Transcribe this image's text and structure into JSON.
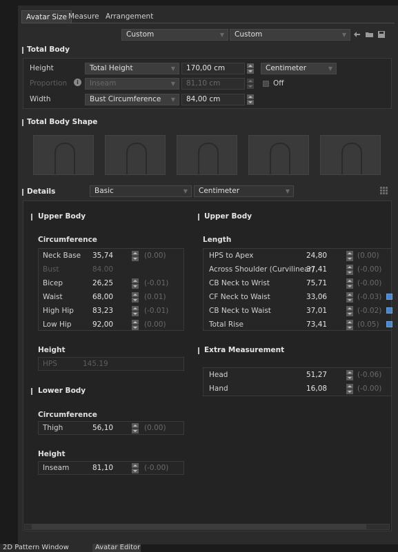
{
  "tabs": [
    "Avatar Size",
    "Measure",
    "Arrangement"
  ],
  "presets": {
    "left": "Custom",
    "right": "Custom"
  },
  "total_body": {
    "title": "Total Body",
    "rows": [
      {
        "label": "Height",
        "dropdown": "Total Height",
        "value": "170,00 cm",
        "unit_dropdown": "Centimeter"
      },
      {
        "label": "Proportion",
        "dropdown": "Inseam",
        "value": "81,10 cm",
        "toggle_label": "Off"
      },
      {
        "label": "Width",
        "dropdown": "Bust Circumference",
        "value": "84,00 cm"
      }
    ]
  },
  "total_body_shape": {
    "title": "Total Body Shape"
  },
  "details": {
    "title": "Details",
    "level_dropdown": "Basic",
    "unit_dropdown": "Centimeter"
  },
  "upper_body_left": {
    "title": "Upper Body",
    "circumference_title": "Circumference",
    "circumference": [
      {
        "name": "Neck Base",
        "value": "35,74",
        "delta": "(0.00)"
      },
      {
        "name": "Bust",
        "value": "84.00",
        "delta": ""
      },
      {
        "name": "Bicep",
        "value": "26,25",
        "delta": "(-0.01)"
      },
      {
        "name": "Waist",
        "value": "68,00",
        "delta": "(0.01)"
      },
      {
        "name": "High Hip",
        "value": "83,23",
        "delta": "(-0.01)"
      },
      {
        "name": "Low Hip",
        "value": "92,00",
        "delta": "(0.00)"
      }
    ],
    "height_title": "Height",
    "height": [
      {
        "name": "HPS",
        "value": "145.19"
      }
    ]
  },
  "lower_body": {
    "title": "Lower Body",
    "circumference_title": "Circumference",
    "circumference": [
      {
        "name": "Thigh",
        "value": "56,10",
        "delta": "(0.00)"
      }
    ],
    "height_title": "Height",
    "height": [
      {
        "name": "Inseam",
        "value": "81,10",
        "delta": "(-0.00)"
      }
    ]
  },
  "upper_body_right": {
    "title": "Upper Body",
    "length_title": "Length",
    "length": [
      {
        "name": "HPS to Apex",
        "value": "24,80",
        "delta": "(0.00)",
        "checked": false
      },
      {
        "name": "Across Shoulder (Curvilinear)",
        "value": "37,41",
        "delta": "(-0.00)",
        "checked": false
      },
      {
        "name": "CB Neck to Wrist",
        "value": "75,71",
        "delta": "(-0.00)",
        "checked": false
      },
      {
        "name": "CF Neck to Waist",
        "value": "33,06",
        "delta": "(-0.03)",
        "checked": true
      },
      {
        "name": "CB Neck to Waist",
        "value": "37,01",
        "delta": "(-0.02)",
        "checked": true
      },
      {
        "name": "Total Rise",
        "value": "73,41",
        "delta": "(0.05)",
        "checked": true
      }
    ]
  },
  "extra_measurement": {
    "title": "Extra Measurement",
    "items": [
      {
        "name": "Head",
        "value": "51,27",
        "delta": "(-0.06)"
      },
      {
        "name": "Hand",
        "value": "16,08",
        "delta": "(-0.00)"
      }
    ]
  },
  "bottom_tabs": [
    "2D Pattern Window",
    "Avatar Editor"
  ],
  "icons": [
    "chevron-down-icon",
    "back-arrow-icon",
    "folder-icon",
    "save-icon",
    "info-icon",
    "grid-icon",
    "checkbox-icon"
  ]
}
